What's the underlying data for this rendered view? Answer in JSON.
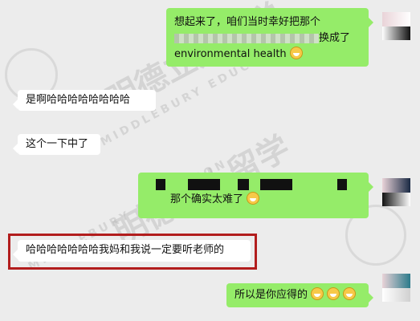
{
  "messages": [
    {
      "side": "out",
      "line1": "想起来了，咱们当时幸好把那个",
      "line2": "换成了",
      "line3": "environmental health"
    },
    {
      "side": "in",
      "text": "是啊哈哈哈哈哈哈哈哈"
    },
    {
      "side": "in",
      "text": "这个一下中了"
    },
    {
      "side": "out",
      "text": "那个确实太难了"
    },
    {
      "side": "in",
      "text": "哈哈哈哈哈哈哈我妈和我说一定要听老师的"
    },
    {
      "side": "out",
      "text": "所以是你应得的"
    }
  ],
  "watermark": {
    "cn": "明德立人留学",
    "en": "MIDDLEBURY EDUCATION"
  },
  "colors": {
    "outgoing": "#95ec69",
    "incoming": "#ffffff",
    "highlight": "#b21d1d",
    "background": "#ececec"
  }
}
